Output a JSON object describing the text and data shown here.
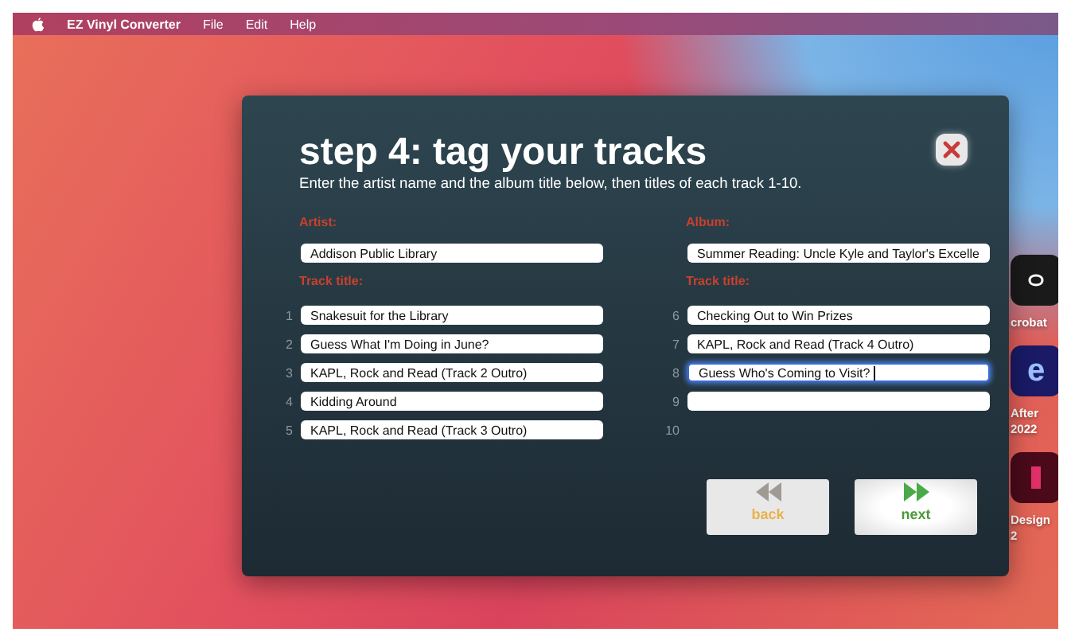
{
  "menubar": {
    "app_name": "EZ Vinyl Converter",
    "menus": [
      "File",
      "Edit",
      "Help"
    ]
  },
  "desktop_icons": [
    {
      "kind": "acrobat",
      "lines": [
        "crobat"
      ]
    },
    {
      "kind": "after",
      "glyph": "e",
      "lines": [
        "After",
        "2022"
      ]
    },
    {
      "kind": "design",
      "lines": [
        "Design",
        "2"
      ]
    }
  ],
  "dialog": {
    "title": "step 4: tag your tracks",
    "instructions": "Enter the artist name and the album title below, then titles of each track 1-10.",
    "artist": {
      "label": "Artist:",
      "value": "Addison Public Library"
    },
    "album": {
      "label": "Album:",
      "value": "Summer Reading: Uncle Kyle and Taylor's Excelle"
    },
    "track_title_labels": [
      "Track title:",
      "Track title:"
    ],
    "tracks": [
      {
        "number": "1",
        "value": "Snakesuit for the Library",
        "focused": false,
        "field": true
      },
      {
        "number": "2",
        "value": "Guess What I'm Doing in June?",
        "focused": false,
        "field": true
      },
      {
        "number": "3",
        "value": "KAPL, Rock and Read (Track 2 Outro)",
        "focused": false,
        "field": true
      },
      {
        "number": "4",
        "value": "Kidding Around",
        "focused": false,
        "field": true
      },
      {
        "number": "5",
        "value": "KAPL, Rock and Read (Track 3 Outro)",
        "focused": false,
        "field": true
      },
      {
        "number": "6",
        "value": "Checking Out to Win Prizes",
        "focused": false,
        "field": true
      },
      {
        "number": "7",
        "value": "KAPL, Rock and Read (Track 4 Outro)",
        "focused": false,
        "field": true
      },
      {
        "number": "8",
        "value": "Guess Who's Coming to Visit?",
        "focused": true,
        "field": true
      },
      {
        "number": "9",
        "focused": false,
        "field": true
      },
      {
        "number": "10",
        "field": false
      }
    ],
    "buttons": [
      {
        "kind": "back",
        "label": "back",
        "disabled": true
      },
      {
        "kind": "next",
        "label": "next",
        "disabled": false
      }
    ]
  }
}
